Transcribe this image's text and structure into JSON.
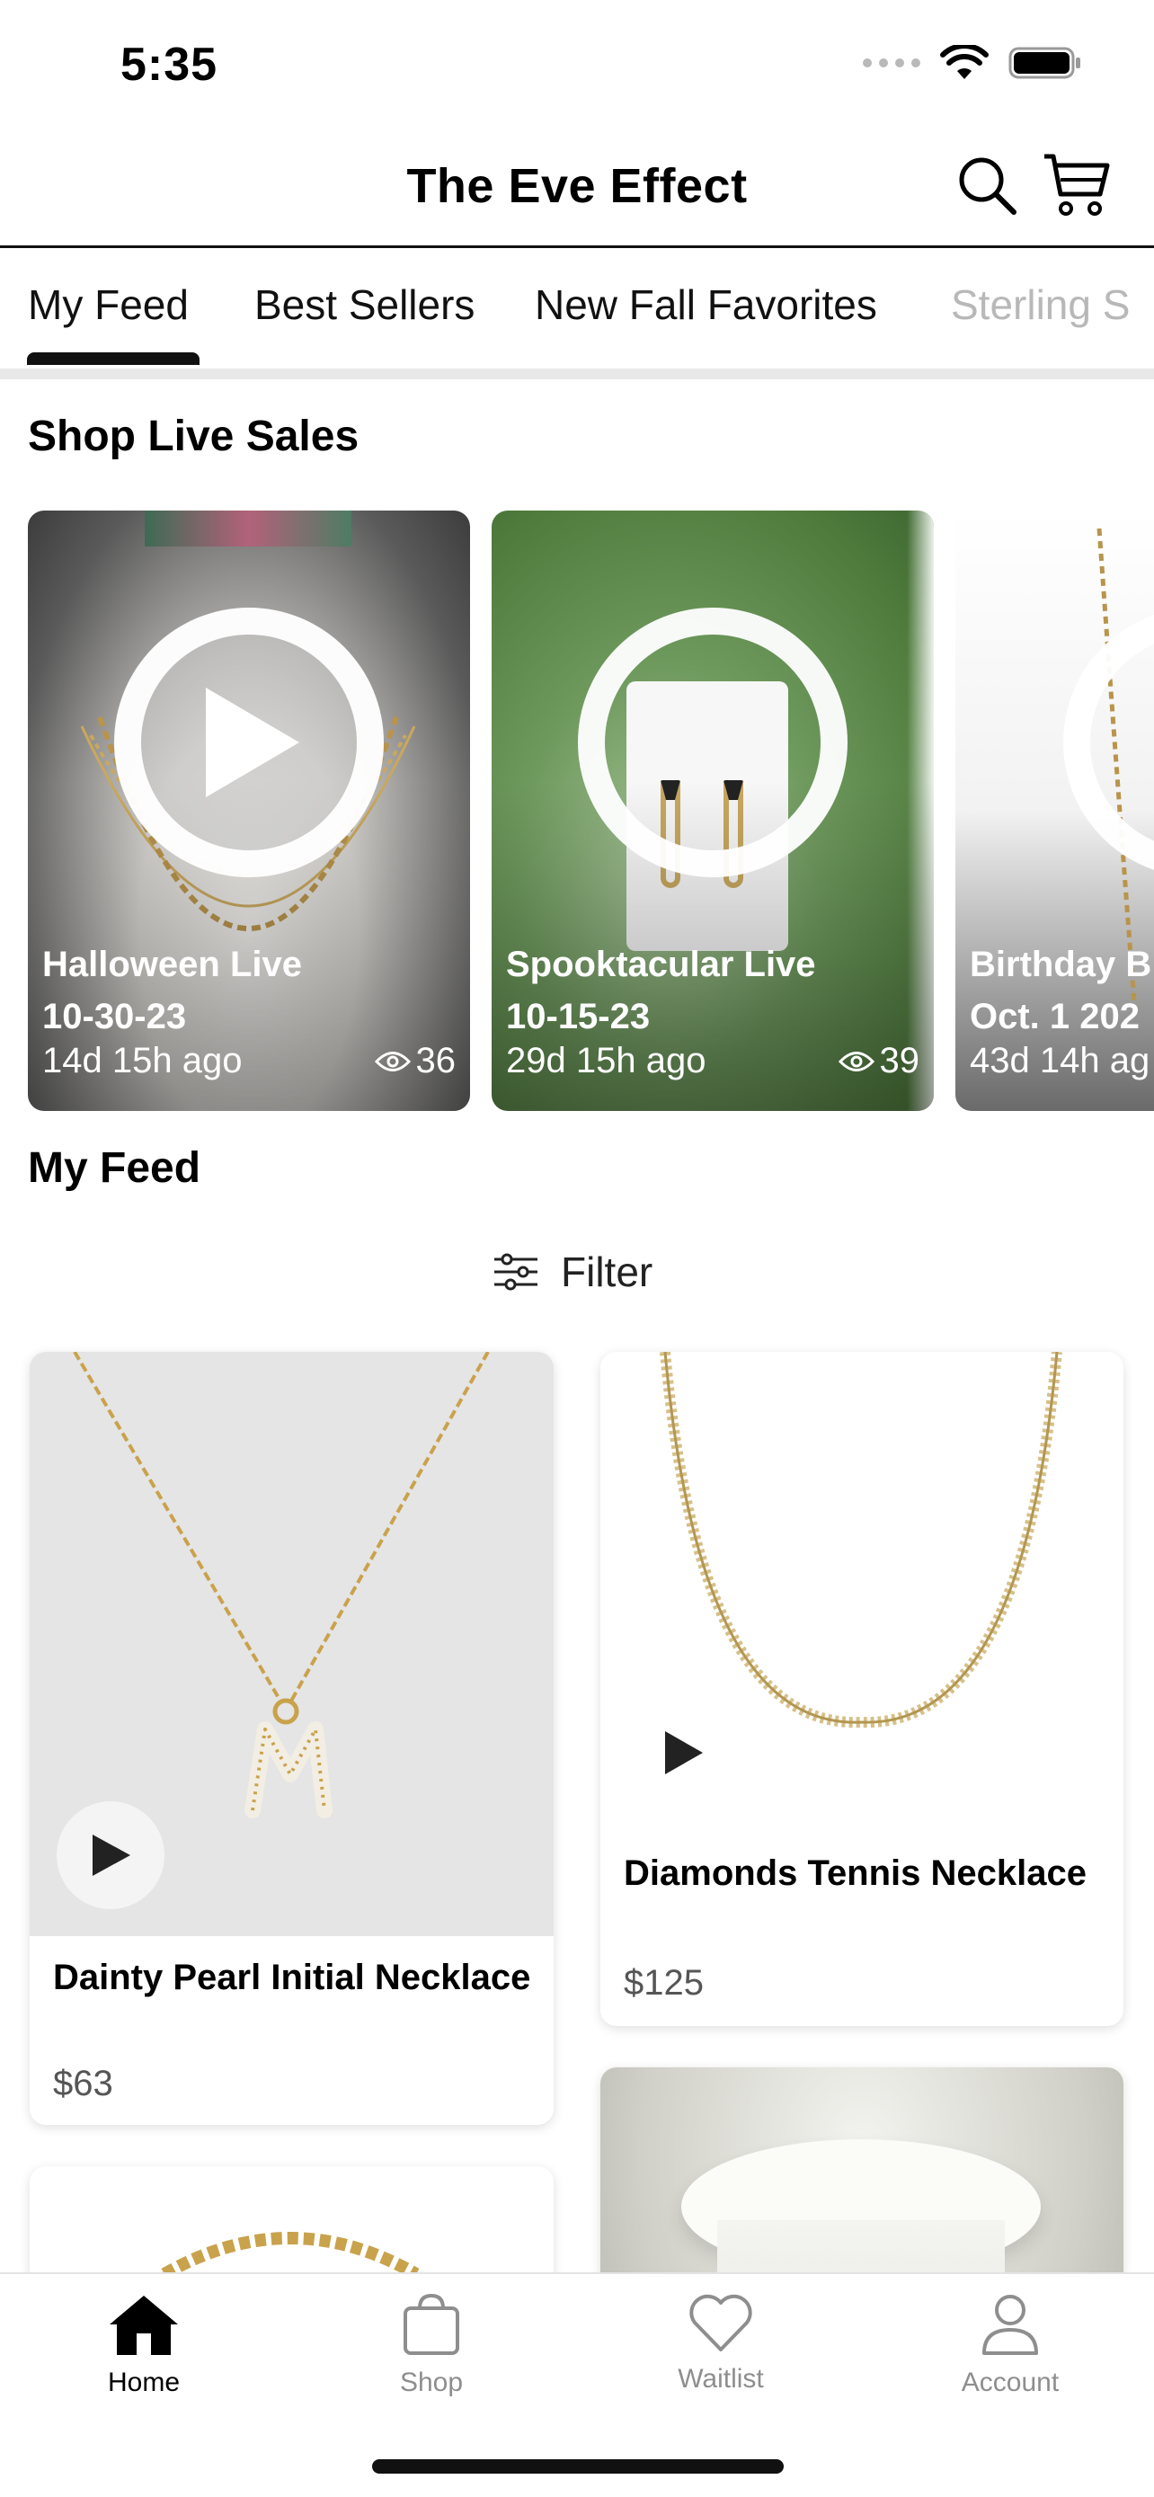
{
  "status": {
    "time": "5:35"
  },
  "header": {
    "title": "The Eve Effect"
  },
  "tabs": [
    "My Feed",
    "Best Sellers",
    "New Fall Favorites",
    "Sterling S"
  ],
  "sections": {
    "live": "Shop Live Sales",
    "feed": "My Feed"
  },
  "live_sales": [
    {
      "title_line1": "Halloween Live",
      "title_line2": "10-30-23",
      "ago": "14d 15h ago",
      "views": "36"
    },
    {
      "title_line1": "Spooktacular Live",
      "title_line2": "10-15-23",
      "ago": "29d 15h ago",
      "views": "39"
    },
    {
      "title_line1": "Birthday B",
      "title_line2": "Oct. 1 202",
      "ago": "43d 14h ag",
      "views": ""
    }
  ],
  "filter": {
    "label": "Filter"
  },
  "products": [
    {
      "name": "Dainty Pearl Initial Necklace",
      "price": "$63"
    },
    {
      "name": "Diamonds Tennis Necklace",
      "price": "$125"
    }
  ],
  "nav": [
    "Home",
    "Shop",
    "Waitlist",
    "Account"
  ],
  "colors": {
    "accent": "#111111",
    "inactive": "#8e8e8e"
  }
}
